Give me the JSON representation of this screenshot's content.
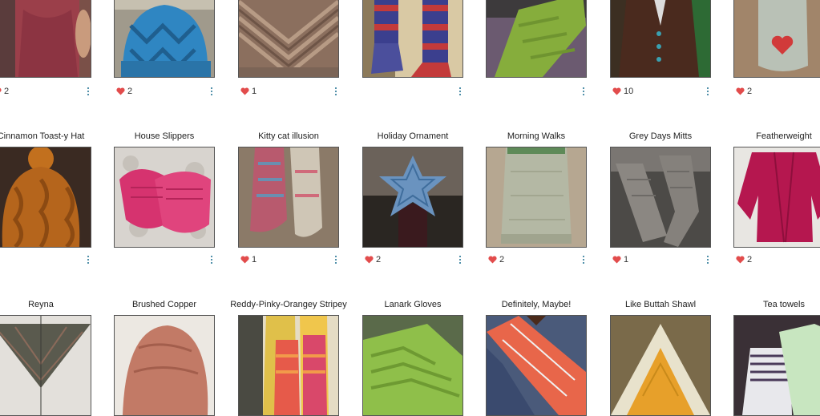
{
  "colors": {
    "heart": "#e24c4c",
    "more": "#1b6e8f"
  },
  "row1": [
    {
      "title": "",
      "likes": "2",
      "img": "red-top-photo"
    },
    {
      "title": "",
      "likes": "2",
      "img": "blue-hat-photo"
    },
    {
      "title": "",
      "likes": "1",
      "img": "lace-shawl-photo"
    },
    {
      "title": "",
      "likes": "",
      "img": "striped-socks-photo"
    },
    {
      "title": "",
      "likes": "",
      "img": "green-mitts-photo"
    },
    {
      "title": "",
      "likes": "10",
      "img": "brown-cardigan-photo"
    },
    {
      "title": "",
      "likes": "2",
      "img": "heart-sock-photo"
    }
  ],
  "row2": [
    {
      "title": "Cinnamon Toast-y Hat",
      "likes": "",
      "img": "orange-hat-photo"
    },
    {
      "title": "House Slippers",
      "likes": "",
      "img": "pink-slippers-photo"
    },
    {
      "title": "Kitty cat illusion",
      "likes": "1",
      "img": "kitty-socks-photo"
    },
    {
      "title": "Holiday Ornament",
      "likes": "2",
      "img": "star-ornament-photo"
    },
    {
      "title": "Morning Walks",
      "likes": "2",
      "img": "grey-green-cowl-photo"
    },
    {
      "title": "Grey Days Mitts",
      "likes": "1",
      "img": "grey-mitts-photo"
    },
    {
      "title": "Featherweight",
      "likes": "2",
      "img": "magenta-cardigan-photo"
    }
  ],
  "row3": [
    {
      "title": "Reyna",
      "img": "reyna-shawl-photo"
    },
    {
      "title": "Brushed Copper",
      "img": "copper-hat-photo"
    },
    {
      "title": "Reddy-Pinky-Orangey Stripey",
      "img": "orange-socks-photo"
    },
    {
      "title": "Lanark Gloves",
      "img": "green-gloves-photo"
    },
    {
      "title": "Definitely, Maybe!",
      "img": "orange-stripe-wrap-photo"
    },
    {
      "title": "Like Buttah Shawl",
      "img": "yellow-shawl-photo"
    },
    {
      "title": "Tea towels",
      "img": "tea-towels-photo"
    }
  ]
}
